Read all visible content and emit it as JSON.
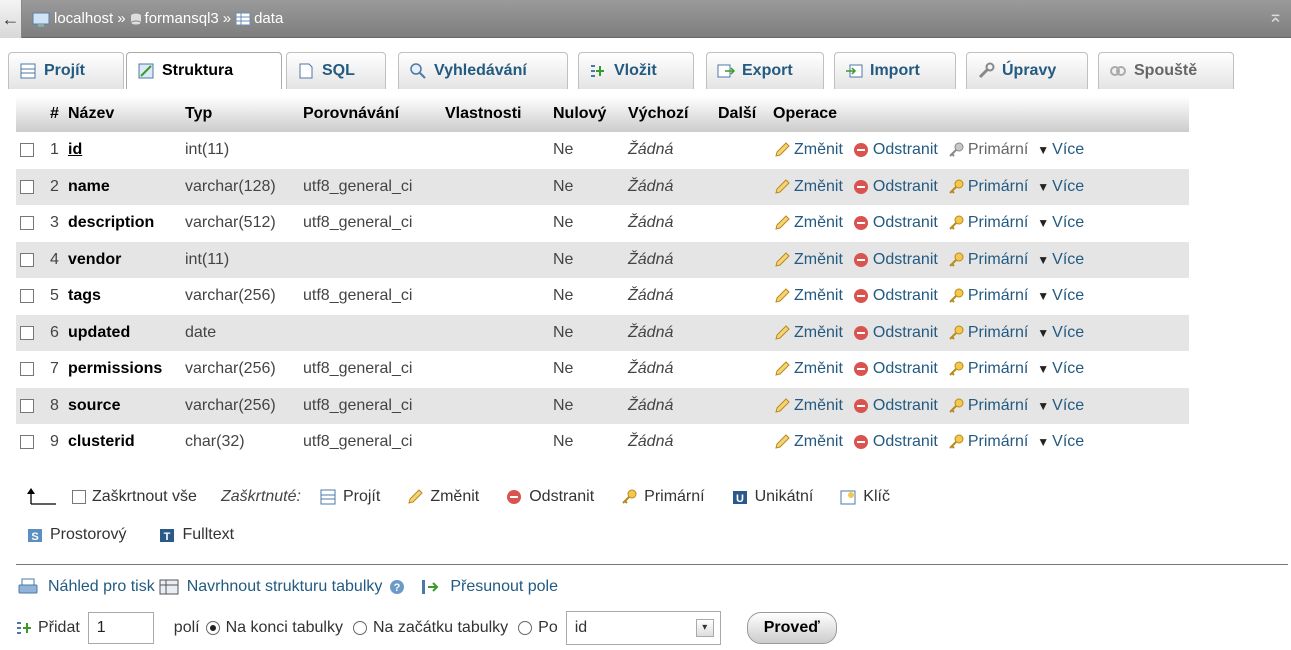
{
  "breadcrumb": {
    "server": "localhost",
    "database": "formansql3",
    "table": "data",
    "separator": "»"
  },
  "tabs": [
    {
      "label": "Projít",
      "icon": "browse-icon"
    },
    {
      "label": "Struktura",
      "icon": "structure-icon",
      "active": true
    },
    {
      "label": "SQL",
      "icon": "sql-icon"
    },
    {
      "label": "Vyhledávání",
      "icon": "search-icon"
    },
    {
      "label": "Vložit",
      "icon": "insert-icon"
    },
    {
      "label": "Export",
      "icon": "export-icon"
    },
    {
      "label": "Import",
      "icon": "import-icon"
    },
    {
      "label": "Úpravy",
      "icon": "operations-icon"
    },
    {
      "label": "Spouště",
      "icon": "triggers-icon",
      "disabled": true
    }
  ],
  "table": {
    "headers": [
      "#",
      "Název",
      "Typ",
      "Porovnávání",
      "Vlastnosti",
      "Nulový",
      "Výchozí",
      "Další",
      "Operace"
    ],
    "actions": {
      "edit": "Změnit",
      "drop": "Odstranit",
      "primary": "Primární",
      "more": "Více"
    },
    "rows": [
      {
        "num": "1",
        "name": "id",
        "type": "int(11)",
        "collation": "",
        "null": "Ne",
        "default": "Žádná",
        "is_primary": true
      },
      {
        "num": "2",
        "name": "name",
        "type": "varchar(128)",
        "collation": "utf8_general_ci",
        "null": "Ne",
        "default": "Žádná"
      },
      {
        "num": "3",
        "name": "description",
        "type": "varchar(512)",
        "collation": "utf8_general_ci",
        "null": "Ne",
        "default": "Žádná"
      },
      {
        "num": "4",
        "name": "vendor",
        "type": "int(11)",
        "collation": "",
        "null": "Ne",
        "default": "Žádná"
      },
      {
        "num": "5",
        "name": "tags",
        "type": "varchar(256)",
        "collation": "utf8_general_ci",
        "null": "Ne",
        "default": "Žádná"
      },
      {
        "num": "6",
        "name": "updated",
        "type": "date",
        "collation": "",
        "null": "Ne",
        "default": "Žádná"
      },
      {
        "num": "7",
        "name": "permissions",
        "type": "varchar(256)",
        "collation": "utf8_general_ci",
        "null": "Ne",
        "default": "Žádná"
      },
      {
        "num": "8",
        "name": "source",
        "type": "varchar(256)",
        "collation": "utf8_general_ci",
        "null": "Ne",
        "default": "Žádná"
      },
      {
        "num": "9",
        "name": "clusterid",
        "type": "char(32)",
        "collation": "utf8_general_ci",
        "null": "Ne",
        "default": "Žádná"
      }
    ]
  },
  "bulk": {
    "check_all": "Zaškrtnout vše",
    "with_selected": "Zaškrtnuté:",
    "browse": "Projít",
    "edit": "Změnit",
    "drop": "Odstranit",
    "primary": "Primární",
    "unique": "Unikátní",
    "index": "Klíč",
    "spatial": "Prostorový",
    "fulltext": "Fulltext"
  },
  "links": {
    "print": "Náhled pro tisk",
    "propose": "Navrhnout strukturu tabulky",
    "move": "Přesunout pole"
  },
  "add": {
    "label": "Přidat",
    "count": "1",
    "fields": "polí",
    "at_end": "Na konci tabulky",
    "at_start": "Na začátku tabulky",
    "after": "Po",
    "after_selected": "id",
    "go": "Proveď"
  }
}
